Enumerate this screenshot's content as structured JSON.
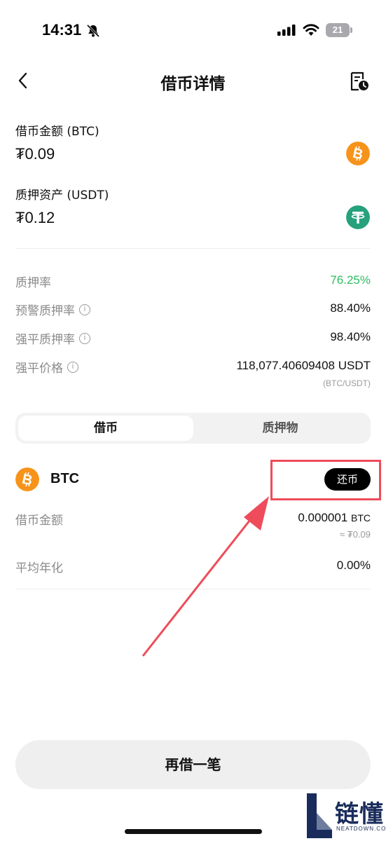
{
  "status_bar": {
    "time": "14:31",
    "battery": "21"
  },
  "header": {
    "title": "借币详情"
  },
  "summary": {
    "borrow_label": "借币金额 (BTC)",
    "borrow_value": "₮0.09",
    "borrow_coin_icon": "bitcoin-icon",
    "collateral_label": "质押资产 (USDT)",
    "collateral_value": "₮0.12",
    "collateral_coin_icon": "tether-icon"
  },
  "stats": [
    {
      "label": "质押率",
      "value": "76.25%",
      "info": false,
      "color": "#2dbd5f"
    },
    {
      "label": "预警质押率",
      "value": "88.40%",
      "info": true
    },
    {
      "label": "强平质押率",
      "value": "98.40%",
      "info": true
    },
    {
      "label": "强平价格",
      "value": "118,077.40609408 USDT",
      "sub": "(BTC/USDT)",
      "info": true
    }
  ],
  "tabs": [
    {
      "label": "借币",
      "active": true
    },
    {
      "label": "质押物",
      "active": false
    }
  ],
  "loan": {
    "coin": "BTC",
    "repay_label": "还币",
    "amount_label": "借币金额",
    "amount_value": "0.000001",
    "amount_unit": "BTC",
    "amount_approx": "≈ ₮0.09",
    "apr_label": "平均年化",
    "apr_value": "0.00%"
  },
  "footer": {
    "borrow_again_label": "再借一笔"
  },
  "watermark": {
    "text": "链懂",
    "sub": "NEATDOWN.COM"
  },
  "colors": {
    "accent_green": "#2dbd5f",
    "bitcoin": "#f7931a",
    "tether": "#26a17b",
    "annotation_red": "#ee4c5a"
  }
}
